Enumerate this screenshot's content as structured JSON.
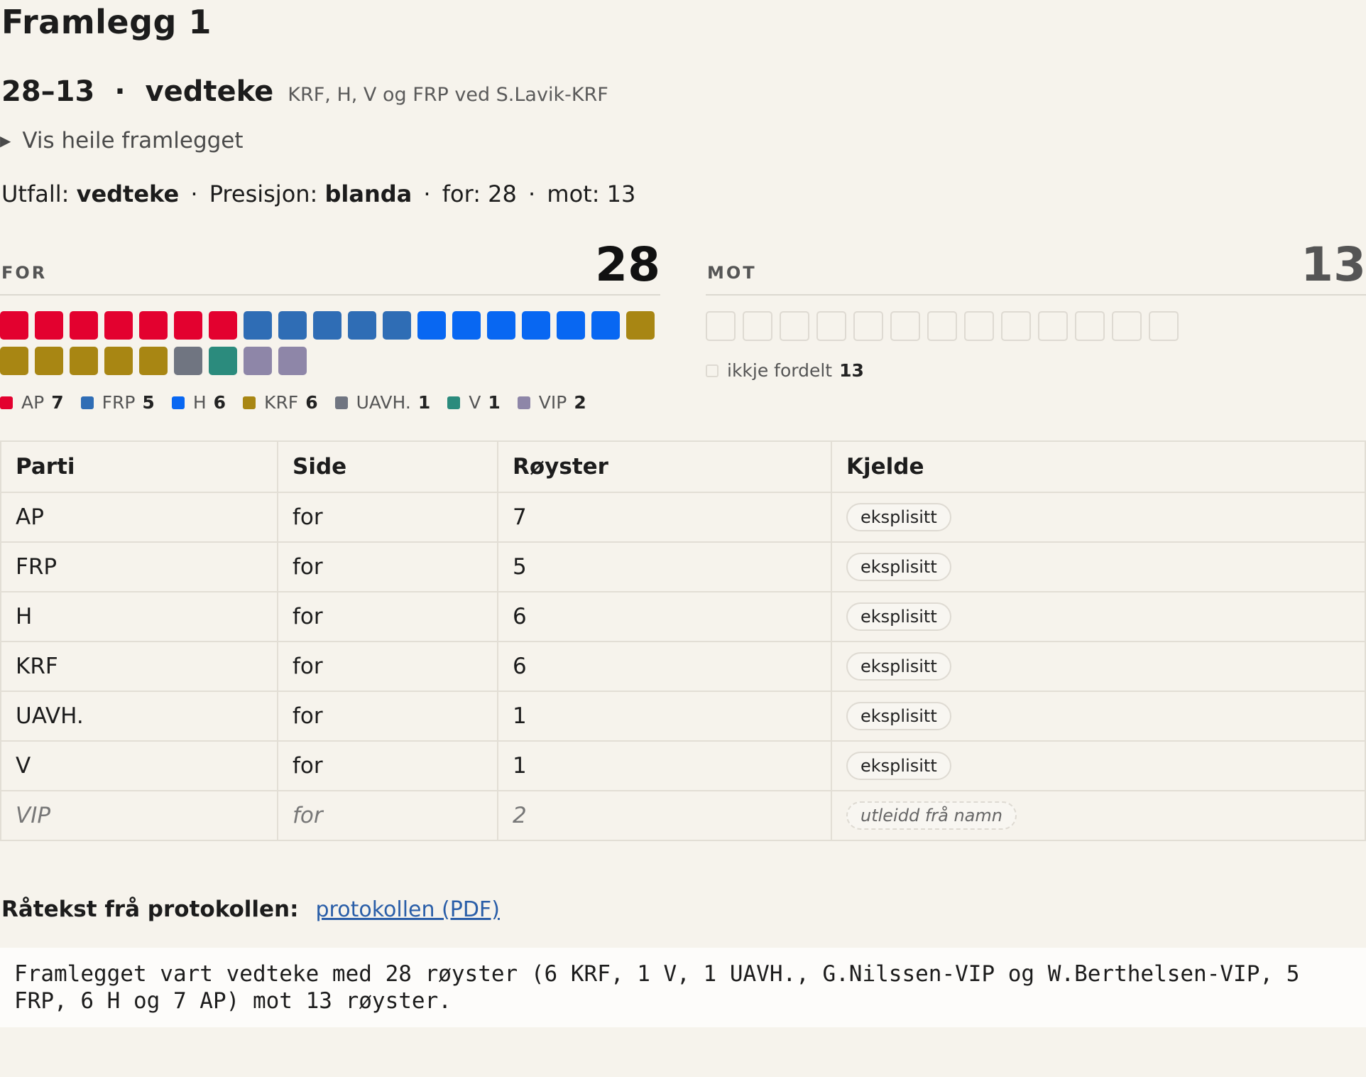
{
  "title": "Framlegg 1",
  "headline": {
    "score": "28–13",
    "dot": "·",
    "outcome": "vedteke",
    "proposer": "KRF, H, V og FRP ved S.Lavik-KRF"
  },
  "details_toggle": "Vis heile framlegget",
  "summary": {
    "outcome_label": "Utfall:",
    "outcome_value": "vedteke",
    "precision_label": "Presisjon:",
    "precision_value": "blanda",
    "for_text": "for: 28",
    "mot_text": "mot: 13",
    "sep": "·"
  },
  "for_column": {
    "label": "FOR",
    "count": "28"
  },
  "mot_column": {
    "label": "MOT",
    "count": "13",
    "unassigned_label": "ikkje fordelt",
    "unassigned_count": "13"
  },
  "parties": [
    {
      "name": "AP",
      "seats": 7,
      "count": "7",
      "color": "#e3012f"
    },
    {
      "name": "FRP",
      "seats": 5,
      "count": "5",
      "color": "#2f6db5"
    },
    {
      "name": "H",
      "seats": 6,
      "count": "6",
      "color": "#0867f2"
    },
    {
      "name": "KRF",
      "seats": 6,
      "count": "6",
      "color": "#a88613"
    },
    {
      "name": "UAVH.",
      "seats": 1,
      "count": "1",
      "color": "#707581"
    },
    {
      "name": "V",
      "seats": 1,
      "count": "1",
      "color": "#2b8b7d"
    },
    {
      "name": "VIP",
      "seats": 2,
      "count": "2",
      "color": "#8e86a8"
    }
  ],
  "table": {
    "headers": [
      "Parti",
      "Side",
      "Røyster",
      "Kjelde"
    ],
    "rows": [
      {
        "party": "AP",
        "side": "for",
        "votes": "7",
        "source": "eksplisitt",
        "inferred": false
      },
      {
        "party": "FRP",
        "side": "for",
        "votes": "5",
        "source": "eksplisitt",
        "inferred": false
      },
      {
        "party": "H",
        "side": "for",
        "votes": "6",
        "source": "eksplisitt",
        "inferred": false
      },
      {
        "party": "KRF",
        "side": "for",
        "votes": "6",
        "source": "eksplisitt",
        "inferred": false
      },
      {
        "party": "UAVH.",
        "side": "for",
        "votes": "1",
        "source": "eksplisitt",
        "inferred": false
      },
      {
        "party": "V",
        "side": "for",
        "votes": "1",
        "source": "eksplisitt",
        "inferred": false
      },
      {
        "party": "VIP",
        "side": "for",
        "votes": "2",
        "source": "utleidd frå namn",
        "inferred": true
      }
    ]
  },
  "raw": {
    "label": "Råtekst frå protokollen:",
    "link_text": "protokollen (PDF)",
    "text": "Framlegget vart vedteke med 28 røyster (6 KRF, 1 V, 1 UAVH., G.Nilssen-VIP og W.Berthelsen-VIP, 5 FRP, 6 H og 7 AP) mot 13 røyster."
  }
}
